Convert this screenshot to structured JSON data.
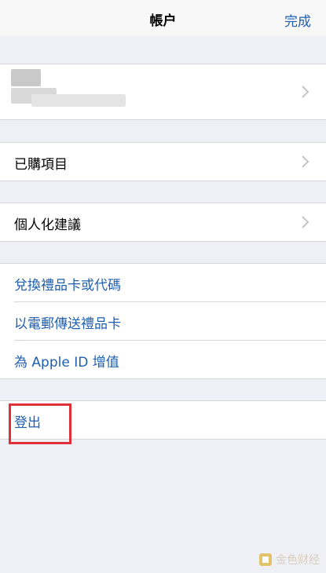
{
  "nav": {
    "title": "帳户",
    "done_label": "完成"
  },
  "rows": {
    "purchased": "已購項目",
    "personalized": "個人化建議",
    "redeem": "兌換禮品卡或代碼",
    "send_gift": "以電郵傳送禮品卡",
    "add_funds": "為 Apple ID 增值",
    "sign_out": "登出"
  },
  "watermark": {
    "text": "金色财经"
  },
  "colors": {
    "link": "#1f5fb0",
    "highlight": "#e0303a",
    "background": "#efeff6"
  }
}
